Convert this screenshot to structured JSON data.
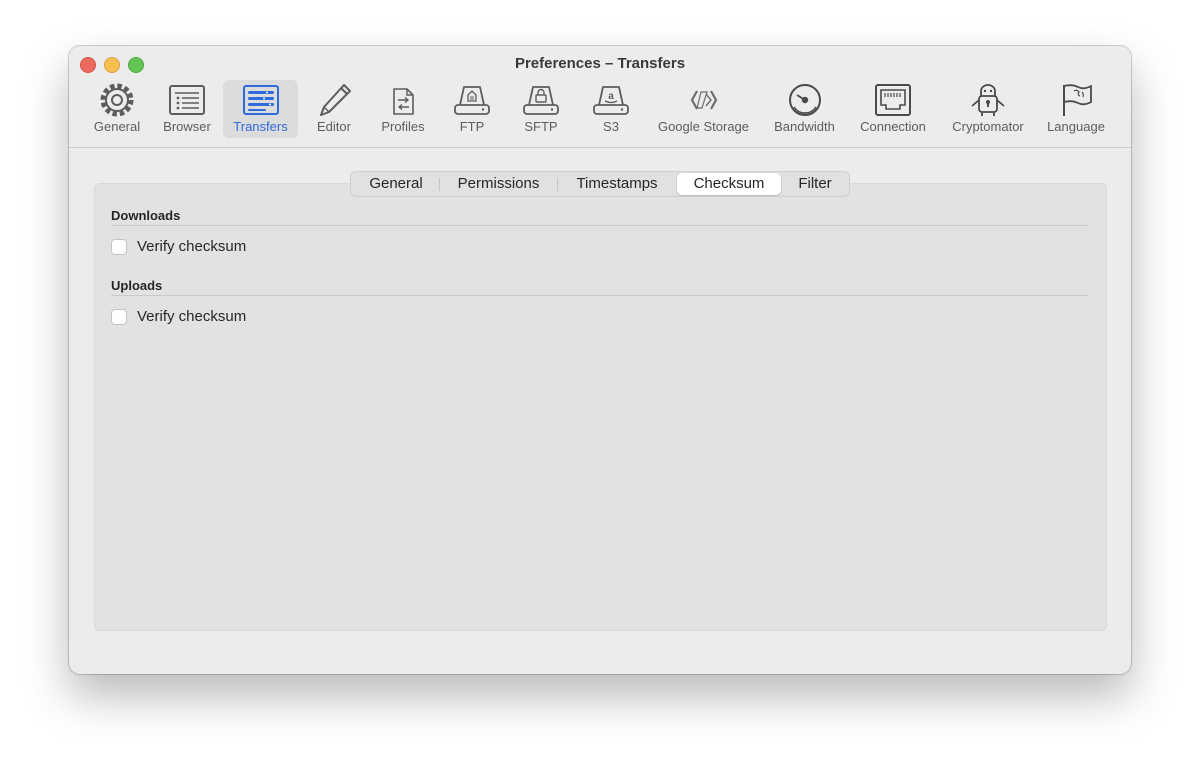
{
  "window": {
    "title": "Preferences – Transfers"
  },
  "toolbar": {
    "items": [
      {
        "label": "General",
        "icon": "gear-icon"
      },
      {
        "label": "Browser",
        "icon": "list-icon"
      },
      {
        "label": "Transfers",
        "icon": "transfers-icon",
        "selected": true
      },
      {
        "label": "Editor",
        "icon": "pencil-icon"
      },
      {
        "label": "Profiles",
        "icon": "profiles-icon"
      },
      {
        "label": "FTP",
        "icon": "ftp-drive-icon"
      },
      {
        "label": "SFTP",
        "icon": "sftp-drive-icon"
      },
      {
        "label": "S3",
        "icon": "s3-drive-icon"
      },
      {
        "label": "Google Storage",
        "icon": "google-storage-icon"
      },
      {
        "label": "Bandwidth",
        "icon": "gauge-icon"
      },
      {
        "label": "Connection",
        "icon": "ethernet-port-icon"
      },
      {
        "label": "Cryptomator",
        "icon": "cryptomator-robot-icon"
      },
      {
        "label": "Language",
        "icon": "flag-icon"
      }
    ],
    "active_color": "#2e6bdc"
  },
  "tabs": {
    "items": [
      "General",
      "Permissions",
      "Timestamps",
      "Checksum",
      "Filter"
    ],
    "selected": "Checksum"
  },
  "downloads": {
    "title": "Downloads",
    "verify_label": "Verify checksum",
    "verify_checked": false
  },
  "uploads": {
    "title": "Uploads",
    "verify_label": "Verify checksum",
    "verify_checked": false
  }
}
